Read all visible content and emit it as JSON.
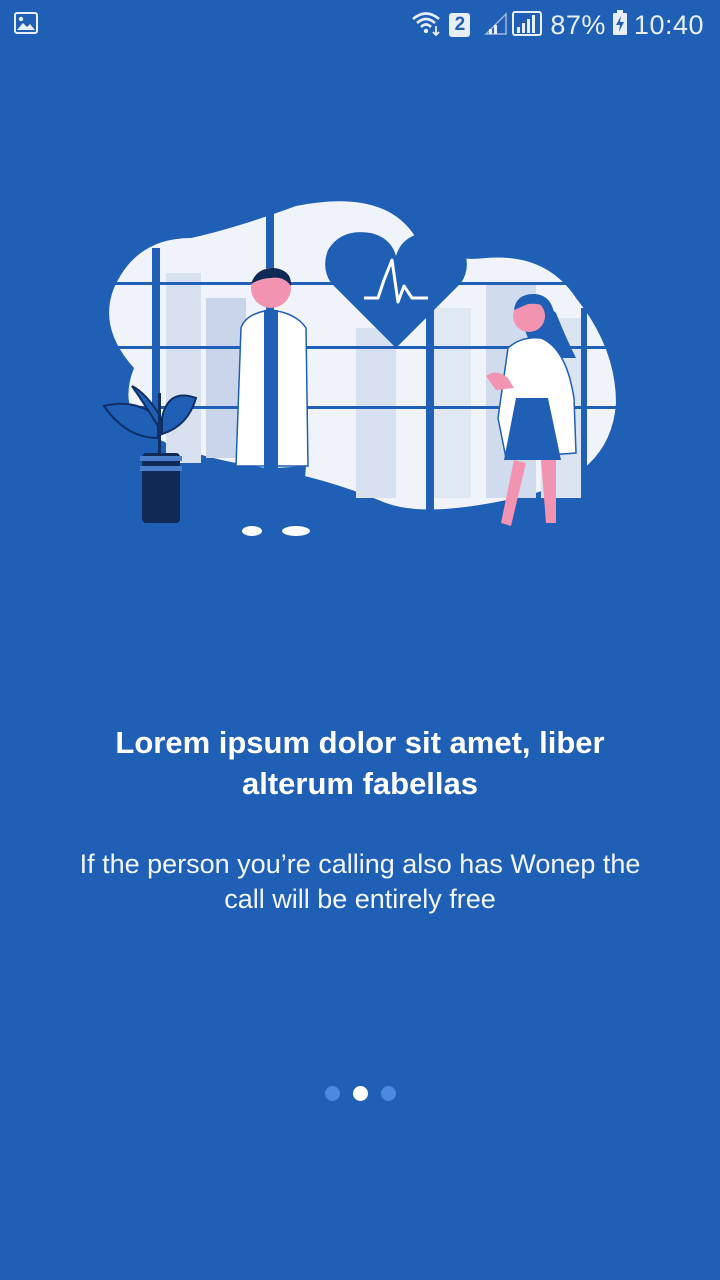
{
  "status_bar": {
    "sim_badge": "2",
    "battery": "87%",
    "time": "10:40"
  },
  "icons": {
    "gallery": "image-icon",
    "wifi": "wifi-icon",
    "signal": "signal-icon",
    "battery": "battery-charging-icon"
  },
  "onboarding": {
    "title_line1": "Lorem ipsum dolor sit amet, liber",
    "title_line2": "alterum fabellas",
    "subtitle_line1": "If the person you’re calling also has Wonep the",
    "subtitle_line2": "call will be entirely free"
  },
  "pager": {
    "total": 3,
    "active_index": 1
  },
  "colors": {
    "background": "#1f5fb5",
    "dot_inactive": "#4b8ae0",
    "dot_active": "#ffffff"
  }
}
